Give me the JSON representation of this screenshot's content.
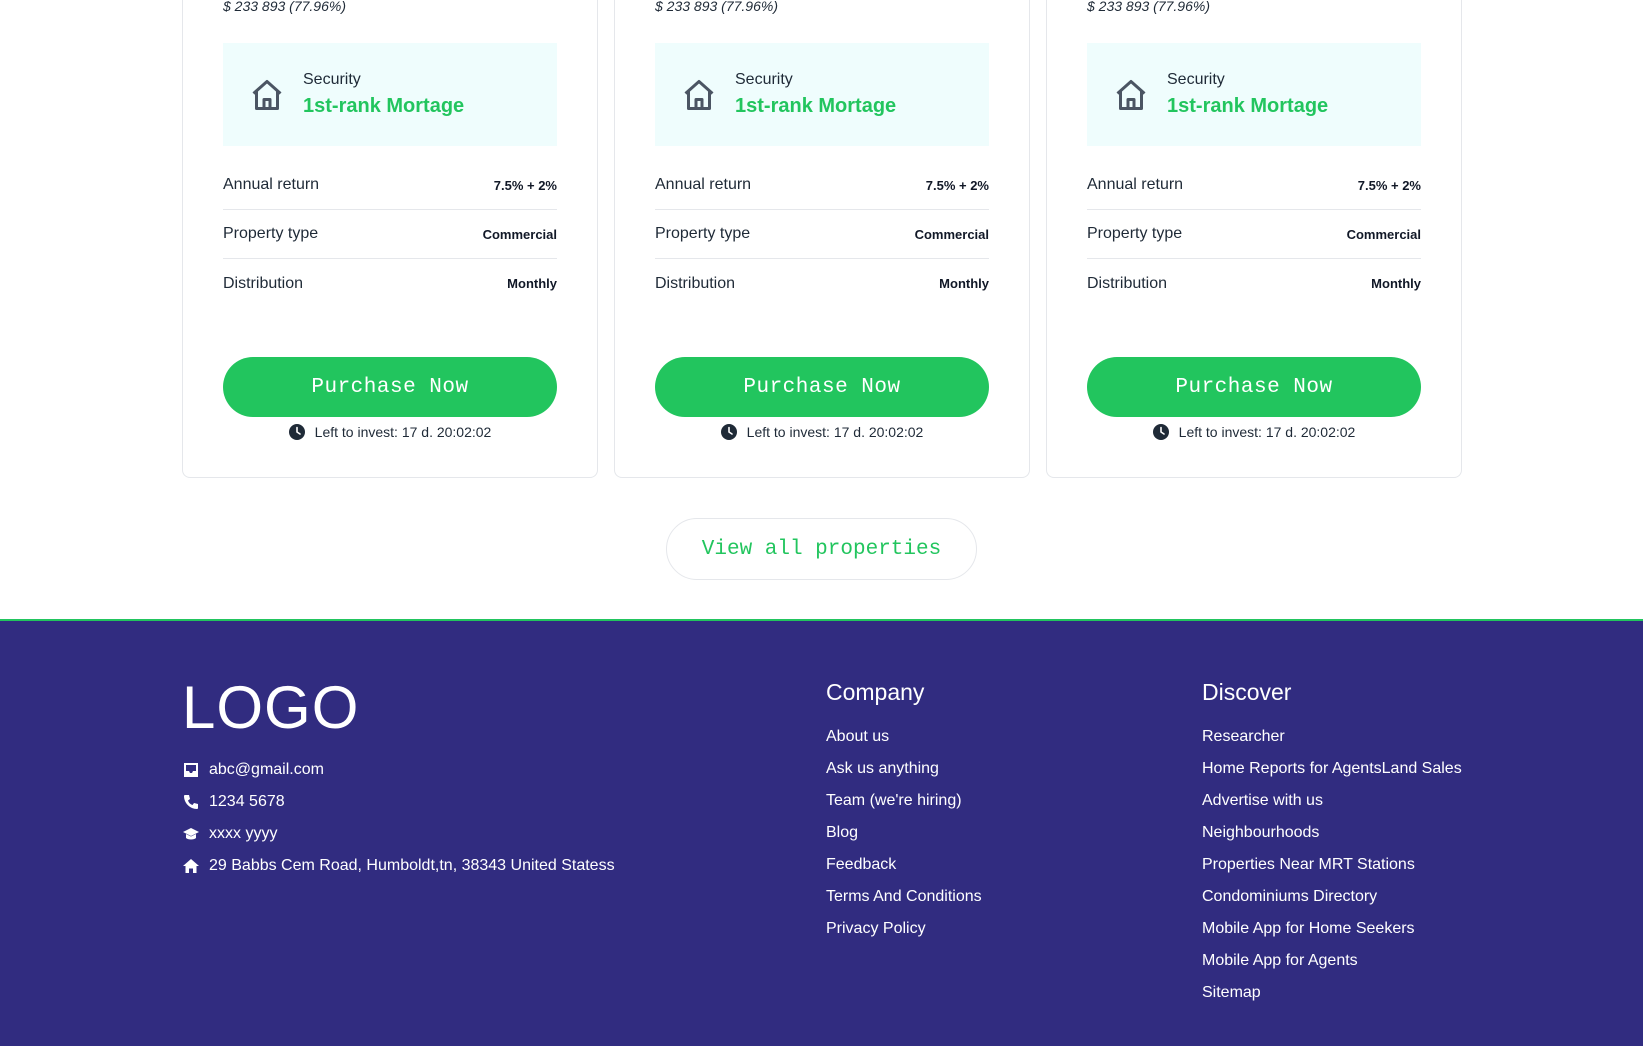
{
  "cards": [
    {
      "raised": "$ 233 893 (77.96%)",
      "security_label": "Security",
      "security_value": "1st-rank Mortage",
      "rows": [
        {
          "label": "Annual return",
          "value": "7.5% + 2%"
        },
        {
          "label": "Property type",
          "value": "Commercial"
        },
        {
          "label": "Distribution",
          "value": "Monthly"
        }
      ],
      "button_label": "Purchase Now",
      "timer_text": "Left to invest: 17 d. 20:02:02"
    },
    {
      "raised": "$ 233 893 (77.96%)",
      "security_label": "Security",
      "security_value": "1st-rank Mortage",
      "rows": [
        {
          "label": "Annual return",
          "value": "7.5% + 2%"
        },
        {
          "label": "Property type",
          "value": "Commercial"
        },
        {
          "label": "Distribution",
          "value": "Monthly"
        }
      ],
      "button_label": "Purchase Now",
      "timer_text": "Left to invest: 17 d. 20:02:02"
    },
    {
      "raised": "$ 233 893 (77.96%)",
      "security_label": "Security",
      "security_value": "1st-rank Mortage",
      "rows": [
        {
          "label": "Annual return",
          "value": "7.5% + 2%"
        },
        {
          "label": "Property type",
          "value": "Commercial"
        },
        {
          "label": "Distribution",
          "value": "Monthly"
        }
      ],
      "button_label": "Purchase Now",
      "timer_text": "Left to invest: 17 d. 20:02:02"
    }
  ],
  "view_all_label": "View all properties",
  "footer": {
    "logo": "LOGO",
    "contacts": {
      "email": "abc@gmail.com",
      "phone": "1234 5678",
      "other": "xxxx yyyy",
      "address": "29 Babbs Cem Road, Humboldt,tn, 38343 United Statess"
    },
    "company": {
      "title": "Company",
      "links": [
        "About us",
        "Ask us anything",
        "Team (we're hiring)",
        "Blog",
        "Feedback",
        "Terms And Conditions",
        "Privacy Policy"
      ]
    },
    "discover": {
      "title": "Discover",
      "links": [
        "Researcher",
        "Home Reports for AgentsLand Sales",
        "Advertise with us",
        "Neighbourhoods",
        "Properties Near MRT Stations",
        "Condominiums Directory",
        "Mobile App for Home Seekers",
        "Mobile App for Agents",
        "Sitemap"
      ]
    }
  },
  "colors": {
    "accent": "#22c55e",
    "footer_bg": "#312c80",
    "security_bg": "#effdfd"
  },
  "icons": {
    "security": "house-icon",
    "timer": "clock-icon",
    "email": "inbox-icon",
    "phone": "phone-icon",
    "other": "graduation-cap-icon",
    "address": "home-icon"
  }
}
